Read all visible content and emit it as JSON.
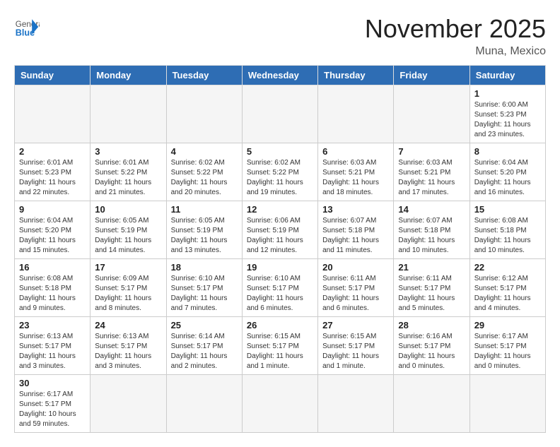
{
  "header": {
    "logo_general": "General",
    "logo_blue": "Blue",
    "month_title": "November 2025",
    "location": "Muna, Mexico"
  },
  "weekdays": [
    "Sunday",
    "Monday",
    "Tuesday",
    "Wednesday",
    "Thursday",
    "Friday",
    "Saturday"
  ],
  "weeks": [
    [
      {
        "day": "",
        "info": ""
      },
      {
        "day": "",
        "info": ""
      },
      {
        "day": "",
        "info": ""
      },
      {
        "day": "",
        "info": ""
      },
      {
        "day": "",
        "info": ""
      },
      {
        "day": "",
        "info": ""
      },
      {
        "day": "1",
        "info": "Sunrise: 6:00 AM\nSunset: 5:23 PM\nDaylight: 11 hours\nand 23 minutes."
      }
    ],
    [
      {
        "day": "2",
        "info": "Sunrise: 6:01 AM\nSunset: 5:23 PM\nDaylight: 11 hours\nand 22 minutes."
      },
      {
        "day": "3",
        "info": "Sunrise: 6:01 AM\nSunset: 5:22 PM\nDaylight: 11 hours\nand 21 minutes."
      },
      {
        "day": "4",
        "info": "Sunrise: 6:02 AM\nSunset: 5:22 PM\nDaylight: 11 hours\nand 20 minutes."
      },
      {
        "day": "5",
        "info": "Sunrise: 6:02 AM\nSunset: 5:22 PM\nDaylight: 11 hours\nand 19 minutes."
      },
      {
        "day": "6",
        "info": "Sunrise: 6:03 AM\nSunset: 5:21 PM\nDaylight: 11 hours\nand 18 minutes."
      },
      {
        "day": "7",
        "info": "Sunrise: 6:03 AM\nSunset: 5:21 PM\nDaylight: 11 hours\nand 17 minutes."
      },
      {
        "day": "8",
        "info": "Sunrise: 6:04 AM\nSunset: 5:20 PM\nDaylight: 11 hours\nand 16 minutes."
      }
    ],
    [
      {
        "day": "9",
        "info": "Sunrise: 6:04 AM\nSunset: 5:20 PM\nDaylight: 11 hours\nand 15 minutes."
      },
      {
        "day": "10",
        "info": "Sunrise: 6:05 AM\nSunset: 5:19 PM\nDaylight: 11 hours\nand 14 minutes."
      },
      {
        "day": "11",
        "info": "Sunrise: 6:05 AM\nSunset: 5:19 PM\nDaylight: 11 hours\nand 13 minutes."
      },
      {
        "day": "12",
        "info": "Sunrise: 6:06 AM\nSunset: 5:19 PM\nDaylight: 11 hours\nand 12 minutes."
      },
      {
        "day": "13",
        "info": "Sunrise: 6:07 AM\nSunset: 5:18 PM\nDaylight: 11 hours\nand 11 minutes."
      },
      {
        "day": "14",
        "info": "Sunrise: 6:07 AM\nSunset: 5:18 PM\nDaylight: 11 hours\nand 10 minutes."
      },
      {
        "day": "15",
        "info": "Sunrise: 6:08 AM\nSunset: 5:18 PM\nDaylight: 11 hours\nand 10 minutes."
      }
    ],
    [
      {
        "day": "16",
        "info": "Sunrise: 6:08 AM\nSunset: 5:18 PM\nDaylight: 11 hours\nand 9 minutes."
      },
      {
        "day": "17",
        "info": "Sunrise: 6:09 AM\nSunset: 5:17 PM\nDaylight: 11 hours\nand 8 minutes."
      },
      {
        "day": "18",
        "info": "Sunrise: 6:10 AM\nSunset: 5:17 PM\nDaylight: 11 hours\nand 7 minutes."
      },
      {
        "day": "19",
        "info": "Sunrise: 6:10 AM\nSunset: 5:17 PM\nDaylight: 11 hours\nand 6 minutes."
      },
      {
        "day": "20",
        "info": "Sunrise: 6:11 AM\nSunset: 5:17 PM\nDaylight: 11 hours\nand 6 minutes."
      },
      {
        "day": "21",
        "info": "Sunrise: 6:11 AM\nSunset: 5:17 PM\nDaylight: 11 hours\nand 5 minutes."
      },
      {
        "day": "22",
        "info": "Sunrise: 6:12 AM\nSunset: 5:17 PM\nDaylight: 11 hours\nand 4 minutes."
      }
    ],
    [
      {
        "day": "23",
        "info": "Sunrise: 6:13 AM\nSunset: 5:17 PM\nDaylight: 11 hours\nand 3 minutes."
      },
      {
        "day": "24",
        "info": "Sunrise: 6:13 AM\nSunset: 5:17 PM\nDaylight: 11 hours\nand 3 minutes."
      },
      {
        "day": "25",
        "info": "Sunrise: 6:14 AM\nSunset: 5:17 PM\nDaylight: 11 hours\nand 2 minutes."
      },
      {
        "day": "26",
        "info": "Sunrise: 6:15 AM\nSunset: 5:17 PM\nDaylight: 11 hours\nand 1 minute."
      },
      {
        "day": "27",
        "info": "Sunrise: 6:15 AM\nSunset: 5:17 PM\nDaylight: 11 hours\nand 1 minute."
      },
      {
        "day": "28",
        "info": "Sunrise: 6:16 AM\nSunset: 5:17 PM\nDaylight: 11 hours\nand 0 minutes."
      },
      {
        "day": "29",
        "info": "Sunrise: 6:17 AM\nSunset: 5:17 PM\nDaylight: 11 hours\nand 0 minutes."
      }
    ],
    [
      {
        "day": "30",
        "info": "Sunrise: 6:17 AM\nSunset: 5:17 PM\nDaylight: 10 hours\nand 59 minutes."
      },
      {
        "day": "",
        "info": ""
      },
      {
        "day": "",
        "info": ""
      },
      {
        "day": "",
        "info": ""
      },
      {
        "day": "",
        "info": ""
      },
      {
        "day": "",
        "info": ""
      },
      {
        "day": "",
        "info": ""
      }
    ]
  ]
}
